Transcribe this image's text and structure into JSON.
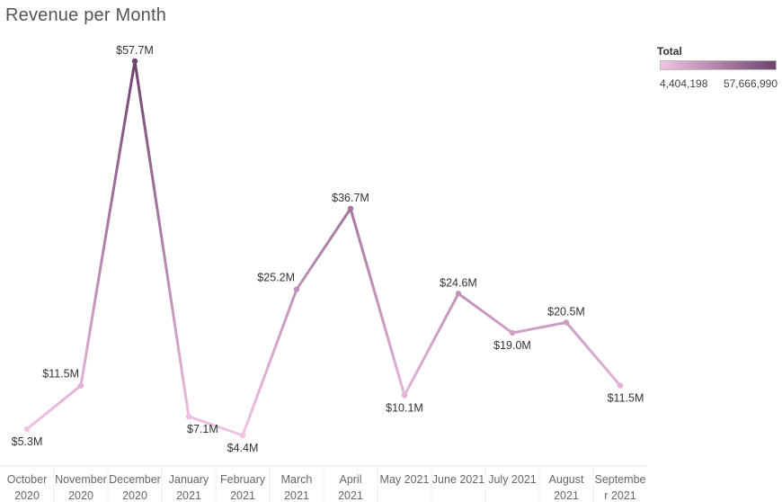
{
  "title": "Revenue per Month",
  "legend": {
    "title": "Total",
    "min_label": "4,404,198",
    "max_label": "57,666,990",
    "color_low": "#f1c4e4",
    "color_high": "#6e4470"
  },
  "chart_data": {
    "type": "line",
    "title": "Revenue per Month",
    "xlabel": "",
    "ylabel": "",
    "grid": false,
    "legend_position": "top-right",
    "color_by": "Total",
    "color_range": [
      4404198,
      57666990
    ],
    "categories": [
      [
        "October",
        "2020"
      ],
      [
        "November",
        "2020"
      ],
      [
        "December",
        "2020"
      ],
      [
        "January",
        "2021"
      ],
      [
        "February",
        "2021"
      ],
      [
        "March",
        "2021"
      ],
      [
        "April",
        "2021"
      ],
      [
        "May 2021"
      ],
      [
        "June 2021"
      ],
      [
        "July 2021"
      ],
      [
        "August",
        "2021"
      ],
      [
        "Septembe",
        "r 2021"
      ]
    ],
    "values": [
      5.3,
      11.5,
      57.7,
      7.1,
      4.4,
      25.2,
      36.7,
      10.1,
      24.6,
      19.0,
      20.5,
      11.5
    ],
    "data_labels": [
      "$5.3M",
      "$11.5M",
      "$57.7M",
      "$7.1M",
      "$4.4M",
      "$25.2M",
      "$36.7M",
      "$10.1M",
      "$24.6M",
      "$19.0M",
      "$20.5M",
      "$11.5M"
    ],
    "unit": "$M"
  }
}
